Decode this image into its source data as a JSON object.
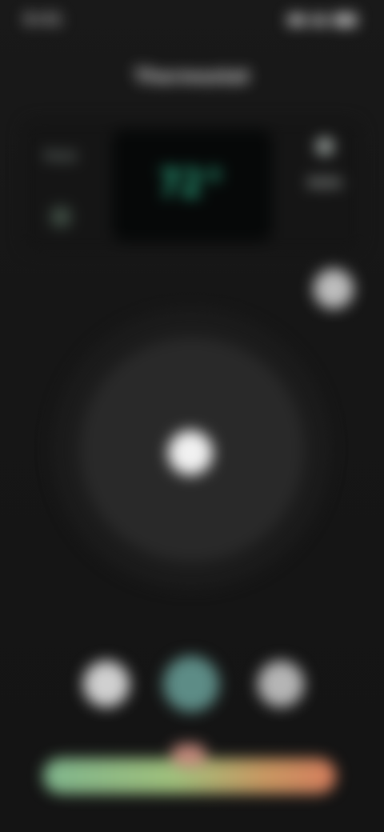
{
  "status_bar": {
    "time": "9:41"
  },
  "header": {
    "title": "Thermostat"
  },
  "top_panel": {
    "left_label": "Mode",
    "display_value": "72°",
    "right_label": "Auto"
  },
  "dial": {
    "target_icon": "dial-center-dot"
  },
  "controls": {
    "left_button_icon": "circle-button",
    "center_button_icon": "circle-button",
    "right_button_icon": "circle-button"
  },
  "footer": {
    "bar_icon": "color-gradient-bar"
  },
  "colors": {
    "background": "#151515",
    "accent": "#2fb58a",
    "accent_teal": "#5d8c86",
    "gradient_start": "#7fb58d",
    "gradient_end": "#d67d5d"
  }
}
